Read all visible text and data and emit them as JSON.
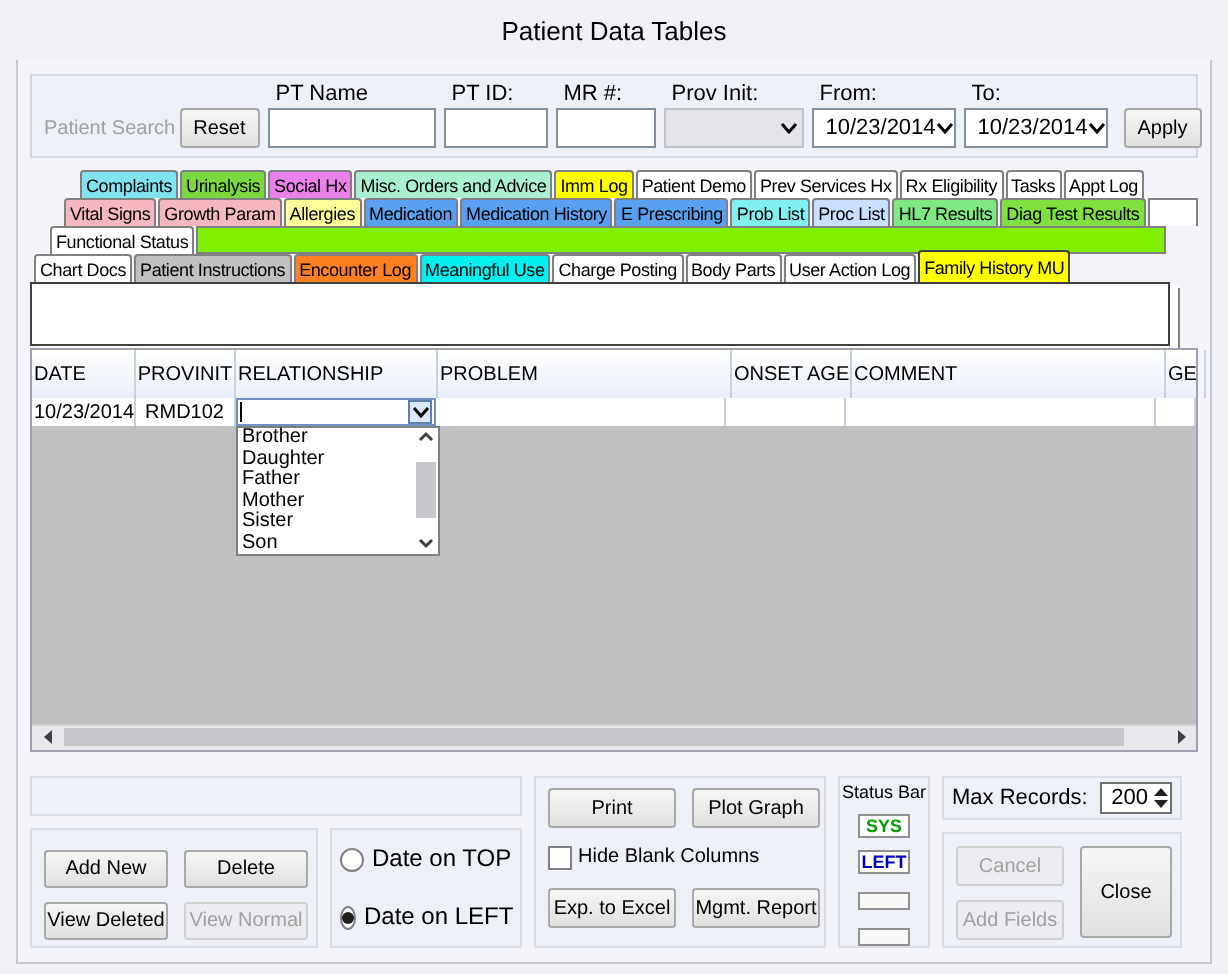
{
  "window": {
    "title": "Patient Data Tables"
  },
  "search": {
    "patient_search": {
      "label": "Patient Search",
      "disabled": true
    },
    "reset": "Reset",
    "apply": "Apply",
    "fields": [
      {
        "label": "PT Name",
        "kind": "text",
        "disabled": false
      },
      {
        "label": "PT ID:",
        "kind": "text",
        "disabled": false
      },
      {
        "label": "MR #:",
        "kind": "text",
        "disabled": false
      },
      {
        "label": "Prov Init:",
        "kind": "select",
        "disabled": true
      },
      {
        "label": "From:",
        "kind": "date",
        "value": "10/23/2014",
        "disabled": false
      },
      {
        "label": "To:",
        "kind": "date",
        "value": "10/23/2014",
        "disabled": false
      }
    ]
  },
  "tab_rows": [
    {
      "tabs": [
        {
          "label": "Complaints",
          "color": "#80e4f0",
          "selected": false
        },
        {
          "label": "Urinalysis",
          "color": "#7cd840",
          "selected": false
        },
        {
          "label": "Social Hx",
          "color": "#ea80ea",
          "selected": false
        },
        {
          "label": "Misc. Orders and Advice",
          "color": "#a8f0d0",
          "selected": false
        },
        {
          "label": "Imm Log",
          "color": "#ffff00",
          "selected": false
        },
        {
          "label": "Patient Demo",
          "color": "#ffffff",
          "selected": false
        },
        {
          "label": "Prev Services Hx",
          "color": "#ffffff",
          "selected": false
        },
        {
          "label": "Rx Eligibility",
          "color": "#ffffff",
          "selected": false
        },
        {
          "label": "Tasks",
          "color": "#ffffff",
          "selected": false
        },
        {
          "label": "Appt Log",
          "color": "#ffffff",
          "selected": false
        }
      ]
    },
    {
      "tabs": [
        {
          "label": "Vital Signs",
          "color": "#f5b8c0",
          "selected": false
        },
        {
          "label": "Growth Param",
          "color": "#f5b8c0",
          "selected": false
        },
        {
          "label": "Allergies",
          "color": "#ffff99",
          "selected": false
        },
        {
          "label": "Medication",
          "color": "#5aa0f0",
          "selected": false
        },
        {
          "label": "Medication History",
          "color": "#5aa0f0",
          "selected": false
        },
        {
          "label": "E Prescribing",
          "color": "#5aa0f0",
          "selected": false
        },
        {
          "label": "Prob List",
          "color": "#80f0f0",
          "selected": false
        },
        {
          "label": "Proc List",
          "color": "#c8e0ff",
          "selected": false
        },
        {
          "label": "HL7 Results",
          "color": "#80e880",
          "selected": false
        },
        {
          "label": "Diag Test Results",
          "color": "#80e040",
          "selected": false
        }
      ]
    },
    {
      "tabs": [
        {
          "label": "Functional Status",
          "color": "#ffffff",
          "selected": false
        }
      ]
    },
    {
      "tabs": [
        {
          "label": "Chart Docs",
          "color": "#ffffff",
          "selected": false
        },
        {
          "label": "Patient Instructions",
          "color": "#c0c0c0",
          "selected": false
        },
        {
          "label": "Encounter Log",
          "color": "#ff8020",
          "selected": false
        },
        {
          "label": "Meaningful Use",
          "color": "#00f0f0",
          "selected": false
        },
        {
          "label": "Charge Posting",
          "color": "#ffffff",
          "selected": false
        },
        {
          "label": "Body Parts",
          "color": "#ffffff",
          "selected": false
        },
        {
          "label": "User Action Log",
          "color": "#ffffff",
          "selected": false
        },
        {
          "label": "Family History MU",
          "color": "#ffff00",
          "selected": true
        }
      ]
    }
  ],
  "grid": {
    "columns": [
      "DATE",
      "PROVINIT",
      "RELATIONSHIP",
      "PROBLEM",
      "ONSET AGE",
      "COMMENT",
      "GE"
    ],
    "rows": [
      {
        "date": "10/23/2014",
        "provinit": "RMD102"
      }
    ],
    "relationship_dropdown": {
      "options": [
        "Brother",
        "Daughter",
        "Father",
        "Mother",
        "Sister",
        "Son"
      ]
    }
  },
  "buttons": {
    "add_new": "Add New",
    "delete": "Delete",
    "view_deleted": {
      "label": "View Deleted",
      "disabled": false
    },
    "view_normal": {
      "label": "View Normal",
      "disabled": true
    }
  },
  "date_position": [
    {
      "label": "Date on TOP",
      "selected": false
    },
    {
      "label": "Date on LEFT",
      "selected": true
    }
  ],
  "output": {
    "print": "Print",
    "plot_graph": "Plot Graph",
    "hide_blank_columns": {
      "label": "Hide Blank Columns",
      "checked": false
    },
    "export": "Exp. to Excel",
    "report": "Mgmt. Report"
  },
  "status_bar": {
    "title": "Status Bar",
    "badges": [
      {
        "label": "SYS",
        "color": "#00a000"
      },
      {
        "label": "LEFT",
        "color": "#0000c0"
      }
    ]
  },
  "max_records": {
    "label": "Max Records:",
    "value": "200"
  },
  "actions": [
    {
      "label": "Cancel",
      "disabled": true
    },
    {
      "label": "Add Fields",
      "disabled": true
    },
    {
      "label": "Close",
      "disabled": false
    }
  ]
}
